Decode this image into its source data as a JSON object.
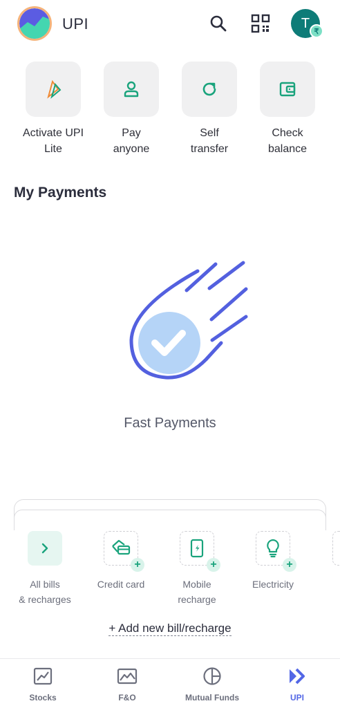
{
  "header": {
    "title": "UPI",
    "avatar_initial": "T",
    "avatar_badge": "₹"
  },
  "quick_actions": [
    {
      "label": "Activate UPI\nLite",
      "icon": "upi-lite-icon"
    },
    {
      "label": "Pay\nanyone",
      "icon": "person-icon"
    },
    {
      "label": "Self\ntransfer",
      "icon": "refresh-icon"
    },
    {
      "label": "Check\nbalance",
      "icon": "wallet-icon"
    }
  ],
  "payments": {
    "section_title": "My Payments",
    "illustration_caption": "Fast Payments"
  },
  "bills": {
    "items": [
      {
        "label": "All bills\n& recharges",
        "icon": "chevron-right-icon"
      },
      {
        "label": "Credit card",
        "icon": "credit-card-icon"
      },
      {
        "label": "Mobile\nrecharge",
        "icon": "mobile-icon"
      },
      {
        "label": "Electricity",
        "icon": "bulb-icon"
      }
    ],
    "add_new": "+ Add new bill/recharge"
  },
  "bottom_nav": [
    {
      "label": "Stocks",
      "icon": "chart-icon",
      "active": false
    },
    {
      "label": "F&O",
      "icon": "fo-icon",
      "active": false
    },
    {
      "label": "Mutual Funds",
      "icon": "pie-icon",
      "active": false
    },
    {
      "label": "UPI",
      "icon": "upi-arrows-icon",
      "active": true
    }
  ],
  "colors": {
    "accent_green": "#19a37c",
    "accent_blue": "#5367e6",
    "avatar_bg": "#0e7c78"
  }
}
